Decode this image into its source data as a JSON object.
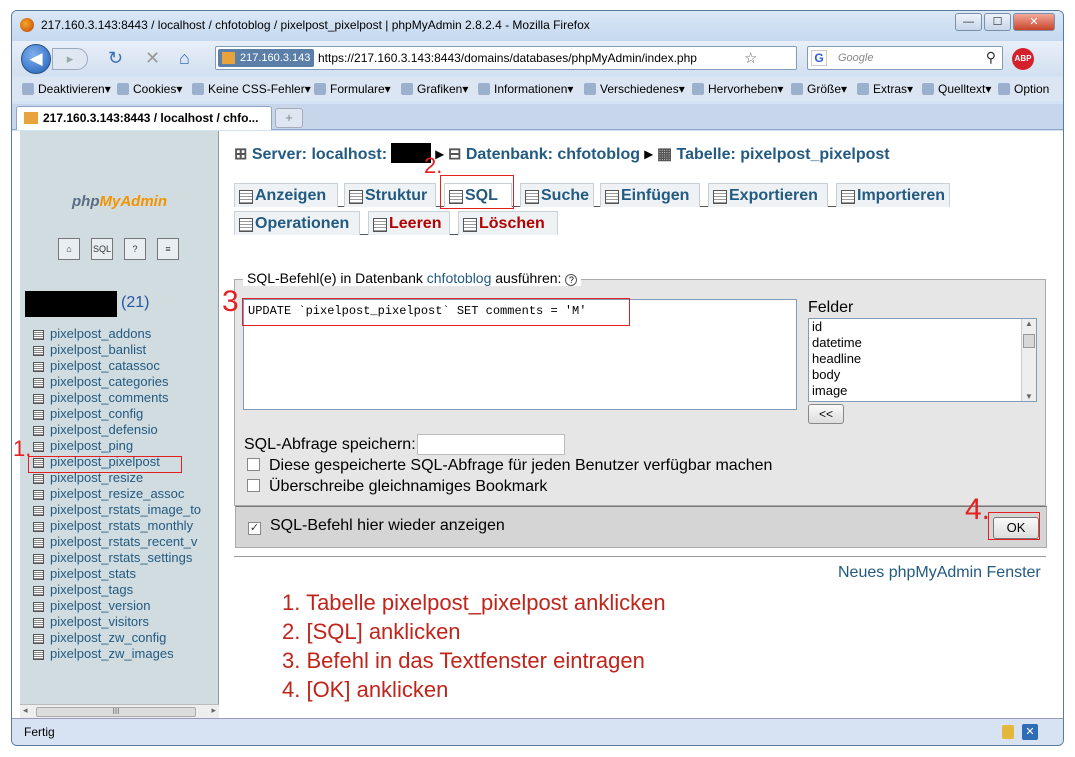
{
  "window": {
    "title": "217.160.3.143:8443 / localhost / chfotoblog / pixelpost_pixelpost | phpMyAdmin 2.8.2.4 - Mozilla Firefox",
    "min": "—",
    "max": "☐",
    "close": "✕"
  },
  "nav": {
    "back": "◀",
    "forward": "▸",
    "reload": "↻",
    "stop": "✕",
    "home": "⌂",
    "site_badge": "217.160.3.143",
    "url": "https://217.160.3.143:8443/domains/databases/phpMyAdmin/index.php",
    "search_placeholder": "Google",
    "abp": "ABP"
  },
  "bookmarks": [
    "Deaktivieren▾",
    "Cookies▾",
    "Keine CSS-Fehler▾",
    "Formulare▾",
    "Grafiken▾",
    "Informationen▾",
    "Verschiedenes▾",
    "Hervorheben▾",
    "Größe▾",
    "Extras▾",
    "Quelltext▾",
    "Option"
  ],
  "tab": {
    "label": "217.160.3.143:8443 / localhost / chfo...",
    "new": "+"
  },
  "left": {
    "logo_php": "php",
    "logo_myadmin": "MyAdmin",
    "icons": [
      "home-icon",
      "sql-icon",
      "docs-icon",
      "query-icon"
    ],
    "db_count": "(21)",
    "tables": [
      "pixelpost_addons",
      "pixelpost_banlist",
      "pixelpost_catassoc",
      "pixelpost_categories",
      "pixelpost_comments",
      "pixelpost_config",
      "pixelpost_defensio",
      "pixelpost_ping",
      "pixelpost_pixelpost",
      "pixelpost_resize",
      "pixelpost_resize_assoc",
      "pixelpost_rstats_image_to",
      "pixelpost_rstats_monthly",
      "pixelpost_rstats_recent_v",
      "pixelpost_rstats_settings",
      "pixelpost_stats",
      "pixelpost_tags",
      "pixelpost_version",
      "pixelpost_visitors",
      "pixelpost_zw_config",
      "pixelpost_zw_images"
    ],
    "scroll_thumb": "III"
  },
  "breadcrumb": {
    "server": "Server: localhost:",
    "db": "Datenbank: chfotoblog",
    "table": "Tabelle: pixelpost_pixelpost"
  },
  "tabs1": [
    "Anzeigen",
    "Struktur",
    "SQL",
    "Suche",
    "Einfügen",
    "Exportieren",
    "Importieren"
  ],
  "tabs2": [
    "Operationen",
    "Leeren",
    "Löschen"
  ],
  "sql_panel": {
    "legend_pre": "SQL-Befehl(e) in Datenbank",
    "legend_db": "chfotoblog",
    "legend_post": "ausführen:",
    "query": "UPDATE `pixelpost_pixelpost` SET comments = 'M'",
    "fields_label": "Felder",
    "fields": [
      "id",
      "datetime",
      "headline",
      "body",
      "image"
    ],
    "insert_btn": "<<",
    "save_label": "SQL-Abfrage speichern:",
    "cb_public": "Diese gespeicherte SQL-Abfrage für jeden Benutzer verfügbar machen",
    "cb_overwrite": "Überschreibe gleichnamiges Bookmark",
    "cb_show_again": "SQL-Befehl hier wieder anzeigen",
    "ok": "OK"
  },
  "new_window": "Neues phpMyAdmin Fenster",
  "annotations": {
    "n1": "1.",
    "n2": "2.",
    "n3": "3",
    "n4": "4.",
    "steps": [
      "1. Tabelle pixelpost_pixelpost anklicken",
      "2. [SQL] anklicken",
      "3. Befehl in das Textfenster eintragen",
      "4. [OK] anklicken"
    ]
  },
  "status": "Fertig",
  "colors": {
    "annotation_red": "#e52020",
    "link_blue": "#235a81"
  }
}
